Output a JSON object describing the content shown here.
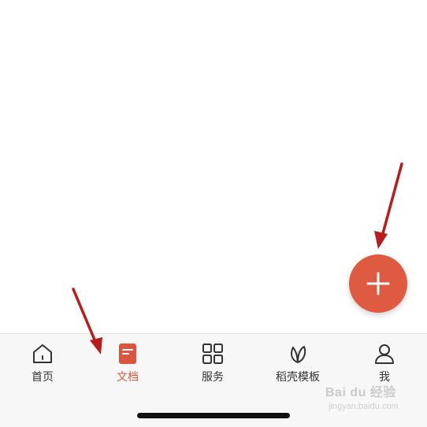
{
  "fab": {
    "icon": "plus-icon",
    "color": "#de5a41"
  },
  "tabbar": {
    "active_color": "#d9553e",
    "tabs": [
      {
        "label": "首页",
        "icon": "home-icon",
        "active": false
      },
      {
        "label": "文档",
        "icon": "document-icon",
        "active": true
      },
      {
        "label": "服务",
        "icon": "grid-icon",
        "active": false
      },
      {
        "label": "稻壳模板",
        "icon": "leaf-icon",
        "active": false
      },
      {
        "label": "我",
        "icon": "person-icon",
        "active": false
      }
    ]
  },
  "annotations": {
    "arrow_color": "#b81c1c"
  },
  "watermark": {
    "brand": "Bai du 经验",
    "url": "jingyan.baidu.com"
  }
}
